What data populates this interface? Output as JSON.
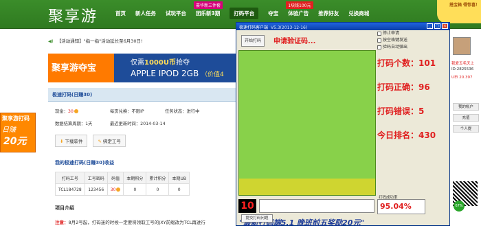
{
  "site": {
    "logo": "聚享游",
    "nav": [
      "首页",
      "新人任务",
      "试玩平台",
      "团乐新3期",
      "打码平台",
      "夺宝",
      "体验广告",
      "推荐好友",
      "兑换商城"
    ],
    "nav_badges": {
      "团乐新3期": "豪华新三件套",
      "体验广告": "1块钱100元"
    },
    "active_nav": "打码平台",
    "corner_badge": "搭宝箱\n得惊喜！"
  },
  "notice": "【活动通知】\"指一指\"活动延长至6月30日!",
  "banner": {
    "left": "聚享游夺宝",
    "line1_prefix": "仅需",
    "line1_highlight": "1000U币",
    "line1_suffix": "抢夺",
    "line2": "APPLE IPOD 2GB",
    "line2_small": "（价值4"
  },
  "left_ad": {
    "line1": "聚享游打码",
    "line2": "日赚",
    "line3": "20元"
  },
  "section": {
    "title": "极速打码(日赚30)",
    "rows": [
      [
        "现金：",
        "30",
        "每页兑换：",
        "不限IP",
        "任务状态：",
        "进行中"
      ],
      [
        "数据结算周期：",
        "1天",
        "最近更新时间：",
        "2014-03-14",
        "",
        ""
      ]
    ],
    "download_btn": "下载软件",
    "bind_btn": "绑定工号"
  },
  "income": {
    "title": "我的极速打码(日赚30)收益",
    "headers": [
      "打码工号",
      "工号密码",
      "码值",
      "本期积分",
      "累计积分",
      "本期UB"
    ],
    "row": [
      "TCL184728",
      "123456",
      "30",
      "0",
      "0",
      "0"
    ]
  },
  "intro": {
    "title": "项目介绍",
    "note_label": "注意：",
    "note_text": "8月2号起，打码迷的时候一定要将领取工号的JXY前缀改为TCL再进行"
  },
  "right_panel": {
    "username": "我爱五毛天上",
    "id": "ID:2825536",
    "balance": "U币 20.397",
    "buttons": [
      "我的帐户",
      "充值",
      "个人提"
    ],
    "progress": "67%"
  },
  "client": {
    "title": "极速打码客户端",
    "version": "V5.3(2013-12-16)",
    "start_button": "开始打码",
    "hint": "申请验证码...",
    "options": [
      "停止申请",
      "按空格键发送",
      "验码自动弹出"
    ],
    "stats": {
      "count_label": "打码个数：",
      "count": "101",
      "correct_label": "打码正确：",
      "correct": "96",
      "error_label": "打码错误：",
      "error": "5",
      "rank_label": "今日排名：",
      "rank": "430"
    },
    "timer": "10",
    "success_rate_label": "打码成功率",
    "success_rate": "95.04%",
    "promo": "\"最新打码端5.1    晚班前五奖励20元\"",
    "report_button": "提交打码问题"
  },
  "colors": {
    "green_header": "#3b8d2a",
    "client_green": "#88d14a",
    "accent_red": "#e02020"
  }
}
